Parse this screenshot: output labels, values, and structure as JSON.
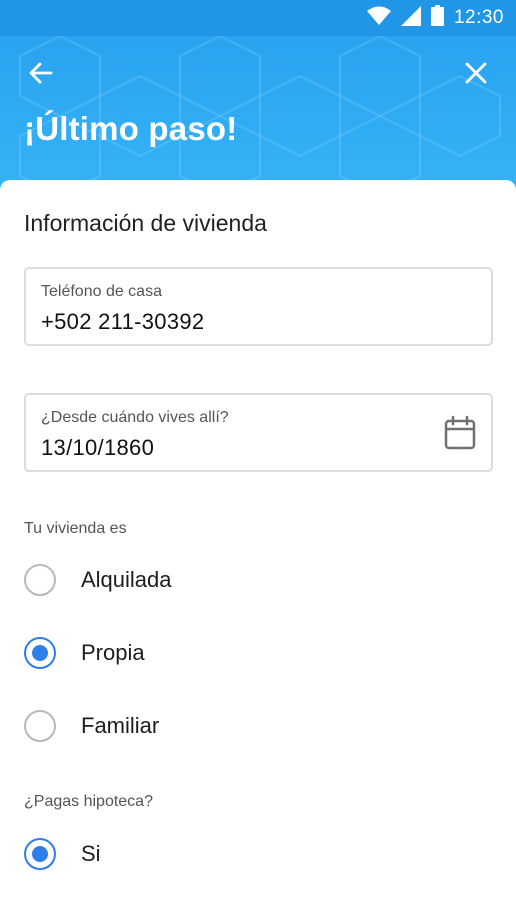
{
  "status_bar": {
    "time": "12:30",
    "icons": [
      "wifi-icon",
      "signal-icon",
      "battery-icon"
    ]
  },
  "header": {
    "title": "¡Último paso!",
    "back_icon": "arrow-left-icon",
    "close_icon": "close-icon"
  },
  "form": {
    "section_title": "Información de vivienda",
    "phone": {
      "label": "Teléfono de casa",
      "value": "+502 211-30392"
    },
    "since": {
      "label": "¿Desde cuándo vives allí?",
      "value": "13/10/1860",
      "icon": "calendar-icon"
    },
    "housing_type": {
      "label": "Tu vivienda es",
      "options": [
        {
          "label": "Alquilada",
          "selected": false
        },
        {
          "label": "Propia",
          "selected": true
        },
        {
          "label": "Familiar",
          "selected": false
        }
      ]
    },
    "mortgage": {
      "label": "¿Pagas hipoteca?",
      "options": [
        {
          "label": "Si",
          "selected": true
        }
      ]
    }
  },
  "colors": {
    "header": "#35b3f7",
    "status_bar": "#2196e6",
    "accent": "#2f7de9",
    "field_border": "#dcdcdc"
  }
}
